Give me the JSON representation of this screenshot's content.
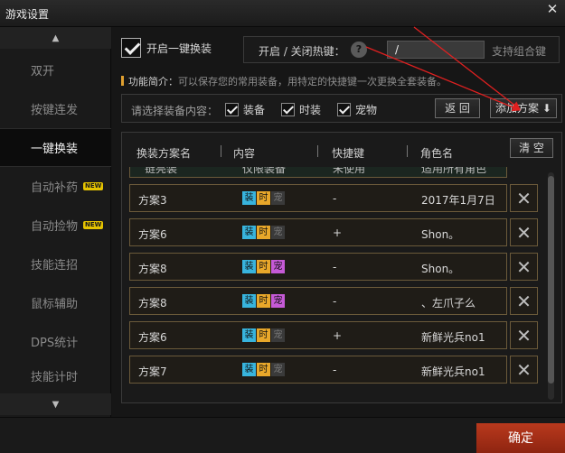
{
  "window": {
    "title": "游戏设置",
    "close_glyph": "✕"
  },
  "sidebar": {
    "up_glyph": "▲",
    "down_glyph": "▼",
    "items": [
      {
        "label": "双开",
        "badge": ""
      },
      {
        "label": "按键连发",
        "badge": ""
      },
      {
        "label": "一键换装",
        "badge": "",
        "active": true
      },
      {
        "label": "自动补药",
        "badge": "NEW"
      },
      {
        "label": "自动捡物",
        "badge": "NEW"
      },
      {
        "label": "技能连招",
        "badge": ""
      },
      {
        "label": "鼠标辅助",
        "badge": ""
      },
      {
        "label": "DPS统计",
        "badge": ""
      },
      {
        "label": "技能计时",
        "badge": ""
      }
    ]
  },
  "settings": {
    "enable_label": "开启一键换装",
    "enable_checked": true,
    "hotkey_label": "开启 / 关闭热键：",
    "help_glyph": "?",
    "hotkey_value": "/",
    "hotkey_note": "支持组合键",
    "intro_title": "功能简介：",
    "intro_text": "可以保存您的常用装备，用特定的快捷键一次更换全套装备。"
  },
  "equip_filter": {
    "label": "请选择装备内容：",
    "options": [
      {
        "label": "装备",
        "checked": true
      },
      {
        "label": "时装",
        "checked": true
      },
      {
        "label": "宠物",
        "checked": true
      }
    ],
    "back_button": "返 回",
    "add_button": "添加方案",
    "add_icon": "⬇"
  },
  "table": {
    "headers": {
      "name": "换装方案名",
      "content": "内容",
      "hotkey": "快捷键",
      "role": "角色名"
    },
    "clear_button": "清 空",
    "partial_row": {
      "name": "链亮装",
      "content": "仅限装备",
      "hotkey": "未使用",
      "role": "适用所有角色"
    },
    "tag_labels": {
      "zhuang": "装",
      "shi": "时",
      "chong": "宠"
    },
    "delete_glyph": "✕",
    "rows": [
      {
        "name": "方案3",
        "tags": [
          true,
          true,
          false
        ],
        "hotkey": "-",
        "role": "2017年1月7日"
      },
      {
        "name": "方案6",
        "tags": [
          true,
          true,
          false
        ],
        "hotkey": "+",
        "role": "Shon。"
      },
      {
        "name": "方案8",
        "tags": [
          true,
          true,
          true
        ],
        "hotkey": "-",
        "role": "Shon。"
      },
      {
        "name": "方案8",
        "tags": [
          true,
          true,
          true
        ],
        "hotkey": "-",
        "role": "、左爪子么"
      },
      {
        "name": "方案6",
        "tags": [
          true,
          true,
          false
        ],
        "hotkey": "+",
        "role": "新鲜光兵no1"
      },
      {
        "name": "方案7",
        "tags": [
          true,
          true,
          false
        ],
        "hotkey": "-",
        "role": "新鲜光兵no1"
      }
    ]
  },
  "footer": {
    "confirm_label": "确定"
  },
  "colors": {
    "accent_red": "#c0392b",
    "tag_zhuang": "#38b4dd",
    "tag_shi": "#e8a72a",
    "tag_chong": "#c55ad6",
    "confirm": "#b9391d"
  }
}
